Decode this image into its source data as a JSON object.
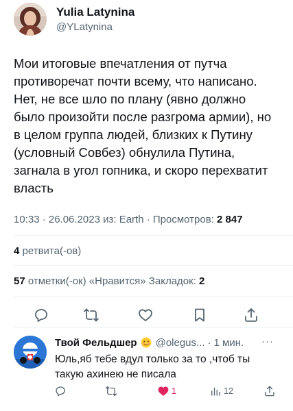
{
  "author": {
    "display_name": "Yulia Latynina",
    "handle": "@YLatynina"
  },
  "tweet": {
    "text": "Мои итоговые впечатления от путча\nпротиворечат почти всему, что написано.\nНет, не все шло по плану (явно должно\nбыло произойти после разгрома армии), но\nв целом группа людей, близких к Путину\n(условный Совбез) обнулила Путина,\nзагнала в угол гопника, и скоро перехватит\nвласть",
    "time": "10:33 · 26.06.2023 из: Earth · Просмотров: ",
    "views": "2 847"
  },
  "stats": {
    "retweets_count": "4",
    "retweets_label": " ретвита(-ов)",
    "likes_count": "57",
    "likes_label": " отметки(-ок) «Нравится»  Закладок: ",
    "bookmarks_count": "2"
  },
  "actions": {
    "reply_icon": "reply-icon",
    "retweet_icon": "retweet-icon",
    "like_icon": "heart-icon",
    "bookmark_icon": "bookmark-icon",
    "share_icon": "share-icon"
  },
  "reply": {
    "name": "Твой Фельдшер",
    "emoji": "smiling-face-emoji",
    "handle": "@olegus...",
    "dot": "·",
    "time": "1 мин.",
    "more": "···",
    "text": "Юль,яб тебе вдул только за то ,чтоб ты такую ахинею не писала",
    "like_count": "1",
    "views_count": "12"
  },
  "colors": {
    "text": "#0f1419",
    "muted": "#536471",
    "divider": "#eff3f4",
    "like": "#e0245e"
  }
}
